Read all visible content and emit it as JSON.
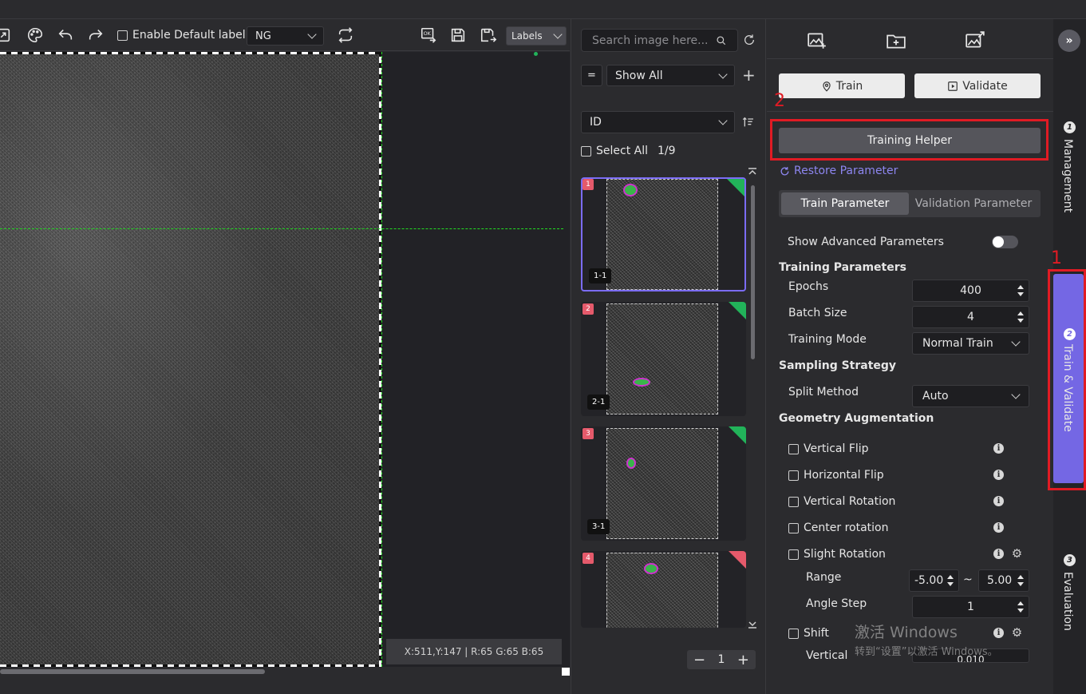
{
  "toolbar": {
    "enable_default_label": "Enable Default label",
    "label_select": "NG",
    "view_select": "Labels",
    "icons": [
      "fit-icon",
      "palette-icon",
      "undo-icon",
      "redo-icon",
      "repeat-icon",
      "ok-icon",
      "save-icon",
      "save-as-icon"
    ]
  },
  "canvas": {
    "status": "X:511,Y:147 | R:65 G:65 B:65",
    "guide_color": "#22dd22"
  },
  "image_list": {
    "search_placeholder": "Search image here...",
    "filter_op": "=",
    "filter_value": "Show All",
    "sort_field": "ID",
    "select_all": "Select All",
    "count": "1/9",
    "items": [
      {
        "num": "1",
        "tag": "1-1",
        "status": "green"
      },
      {
        "num": "2",
        "tag": "2-1",
        "status": "green"
      },
      {
        "num": "3",
        "tag": "3-1",
        "status": "green"
      },
      {
        "num": "4",
        "tag": "",
        "status": "red"
      }
    ],
    "page": "1"
  },
  "panel": {
    "train_btn": "Train",
    "validate_btn": "Validate",
    "training_helper": "Training Helper",
    "restore": "Restore Parameter",
    "tab_train": "Train Parameter",
    "tab_validation": "Validation Parameter",
    "show_advanced": "Show Advanced Parameters",
    "training_parameters": "Training Parameters",
    "epochs_label": "Epochs",
    "epochs_value": "400",
    "batch_label": "Batch Size",
    "batch_value": "4",
    "mode_label": "Training Mode",
    "mode_value": "Normal Train",
    "sampling": "Sampling Strategy",
    "split_label": "Split Method",
    "split_value": "Auto",
    "geometry": "Geometry Augmentation",
    "vflip": "Vertical Flip",
    "hflip": "Horizontal Flip",
    "vrot": "Vertical Rotation",
    "crot": "Center rotation",
    "srot": "Slight Rotation",
    "range_label": "Range",
    "range_min": "-5.00",
    "range_sep": "~",
    "range_max": "5.00",
    "angle_label": "Angle Step",
    "angle_value": "1",
    "shift": "Shift",
    "vertical_label": "Vertical",
    "vertical_value": "0.010"
  },
  "rail": {
    "management": "Management",
    "train_validate": "Train & Validate",
    "evaluation": "Evaluation",
    "n1": "1",
    "n2": "2",
    "n3": "3"
  },
  "annotations": {
    "a1": "1",
    "a2": "2"
  },
  "watermark": {
    "line1": "激活 Windows",
    "line2": "转到“设置”以激活 Windows。"
  },
  "colors": {
    "accent": "#7467e4",
    "highlight": "#e01b24",
    "ok": "#22b35a",
    "ng": "#e55a6b"
  }
}
